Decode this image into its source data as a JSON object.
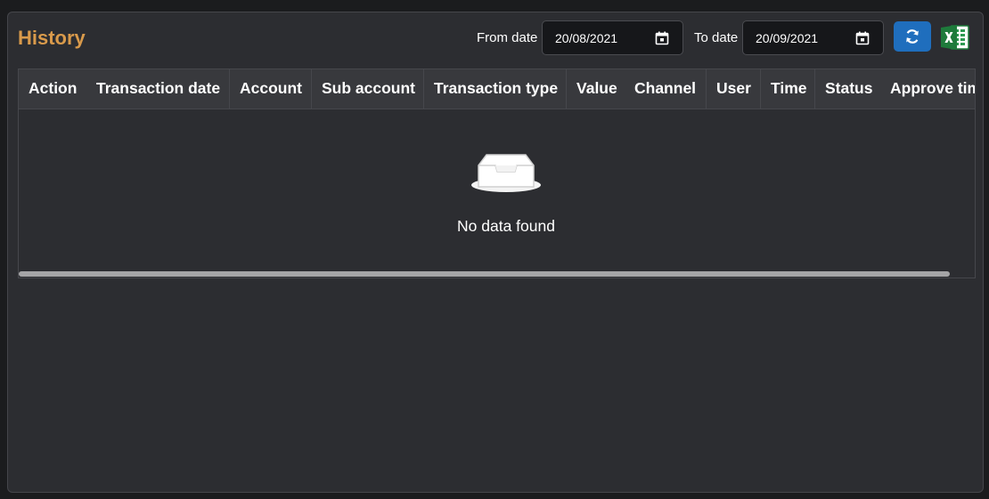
{
  "panel": {
    "title": "History"
  },
  "filters": {
    "from_label": "From date",
    "from_value": "20/08/2021",
    "to_label": "To date",
    "to_value": "20/09/2021"
  },
  "actions": {
    "refresh_icon": "refresh-icon",
    "excel_icon": "excel-icon",
    "refresh_color": "#1f6ebd",
    "excel_color": "#1e7a3b"
  },
  "table": {
    "columns": [
      "Action",
      "Transaction date",
      "Account",
      "Sub account",
      "Transaction type",
      "Value",
      "Channel",
      "User",
      "Time",
      "Status",
      "Approve tim"
    ],
    "empty_text": "No data found",
    "empty_icon": "inbox-icon"
  },
  "colors": {
    "title": "#d99a4b",
    "panel_bg": "#2c2d31",
    "header_bg": "#38393d"
  }
}
